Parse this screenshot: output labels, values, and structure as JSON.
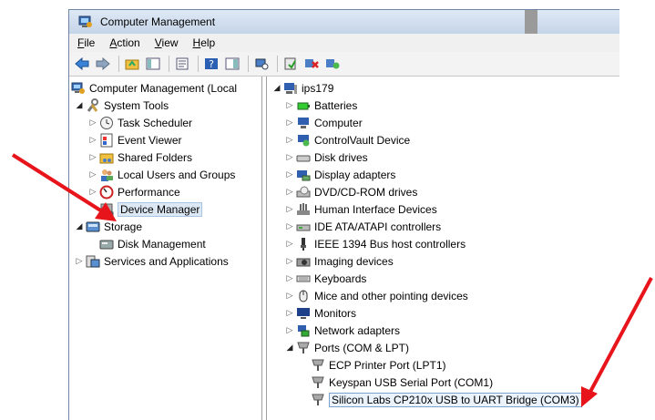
{
  "window": {
    "title": "Computer Management"
  },
  "menu": [
    {
      "accel": "F",
      "rest": "ile"
    },
    {
      "accel": "A",
      "rest": "ction"
    },
    {
      "accel": "V",
      "rest": "iew"
    },
    {
      "accel": "H",
      "rest": "elp"
    }
  ],
  "left_tree": {
    "root": "Computer Management (Local",
    "system_tools": "System Tools",
    "task_scheduler": "Task Scheduler",
    "event_viewer": "Event Viewer",
    "shared_folders": "Shared Folders",
    "local_users": "Local Users and Groups",
    "performance": "Performance",
    "device_manager": "Device Manager",
    "storage": "Storage",
    "disk_management": "Disk Management",
    "services": "Services and Applications"
  },
  "right_tree": {
    "computer_name": "ips179",
    "batteries": "Batteries",
    "computer": "Computer",
    "controlvault": "ControlVault Device",
    "disk_drives": "Disk drives",
    "display_adapters": "Display adapters",
    "dvd": "DVD/CD-ROM drives",
    "hid": "Human Interface Devices",
    "ide": "IDE ATA/ATAPI controllers",
    "ieee": "IEEE 1394 Bus host controllers",
    "imaging": "Imaging devices",
    "keyboards": "Keyboards",
    "mice": "Mice and other pointing devices",
    "monitors": "Monitors",
    "network": "Network adapters",
    "ports": "Ports (COM & LPT)",
    "ecp": "ECP Printer Port (LPT1)",
    "keyspan": "Keyspan USB Serial Port (COM1)",
    "silabs": "Silicon Labs CP210x USB to UART Bridge (COM3)"
  },
  "colors": {
    "arrow": "#e8141b",
    "selection": "#dde8f5",
    "titlebar": "#c4d4e8"
  }
}
